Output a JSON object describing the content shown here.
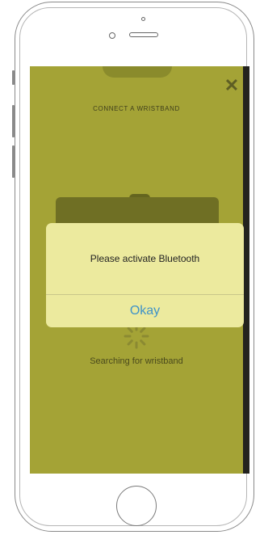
{
  "app": {
    "title": "CONNECT A WRISTBAND",
    "close_symbol": "✕",
    "status_text": "Searching for wristband"
  },
  "dialog": {
    "message": "Please activate Bluetooth",
    "button_label": "Okay"
  },
  "colors": {
    "overlay_tint": "#a4a336",
    "dialog_background": "#ecea9e",
    "button_text": "#3f93c8"
  },
  "icons": [
    "close-icon",
    "spinner-icon"
  ]
}
